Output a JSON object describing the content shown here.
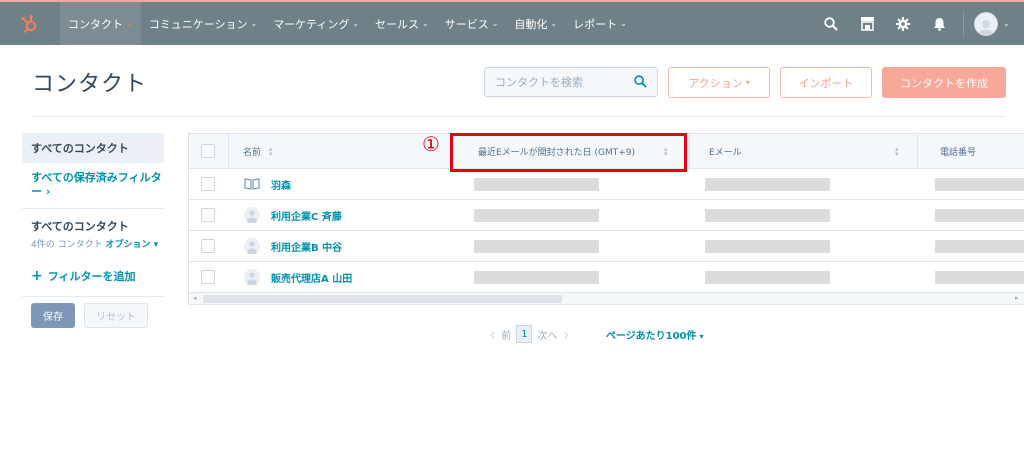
{
  "topbar": {
    "logo": "hubspot-sprocket-logo",
    "nav": [
      {
        "label": "コンタクト",
        "active": true
      },
      {
        "label": "コミュニケーション"
      },
      {
        "label": "マーケティング"
      },
      {
        "label": "セールス"
      },
      {
        "label": "サービス"
      },
      {
        "label": "自動化"
      },
      {
        "label": "レポート"
      }
    ],
    "icons": [
      "search-icon",
      "marketplace-icon",
      "gear-icon",
      "bell-icon",
      "avatar"
    ]
  },
  "header": {
    "title": "コンタクト",
    "search_placeholder": "コンタクトを検索",
    "action_label": "アクション",
    "import_label": "インポート",
    "create_label": "コンタクトを作成"
  },
  "sidebar": {
    "all_contacts": "すべてのコンタクト",
    "saved_filters": "すべての保存済みフィルター ›",
    "current_view": "すべてのコンタクト",
    "count_text": "4件の コンタクト",
    "options_label": "オプション ▾",
    "add_filter": "フィルターを追加",
    "save_label": "保存",
    "reset_label": "リセット"
  },
  "table": {
    "columns": [
      "名前",
      "最近Eメールが開封された日 (GMT+9)",
      "Eメール",
      "電話番号"
    ],
    "rows": [
      {
        "name": "羽森",
        "icon": "book-icon"
      },
      {
        "name": "利用企業C 斉藤",
        "icon": "contact-avatar-icon"
      },
      {
        "name": "利用企業B 中谷",
        "icon": "contact-avatar-icon"
      },
      {
        "name": "販売代理店A 山田",
        "icon": "contact-avatar-icon"
      }
    ]
  },
  "annotation": {
    "marker": "①",
    "color": "#e60012"
  },
  "pagination": {
    "prev": "前",
    "current": "1",
    "next": "次へ",
    "per_page": "ページあたり100件"
  },
  "colors": {
    "topbar": "#708087",
    "link": "#0091ae",
    "accent": "#ff7a59"
  }
}
